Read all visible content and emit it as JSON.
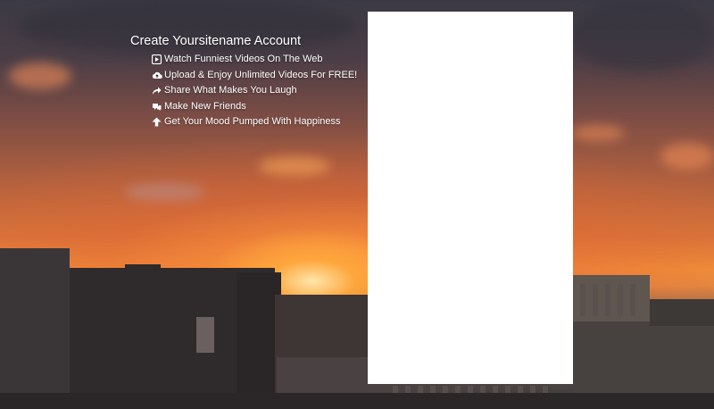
{
  "page": {
    "title": "Create Yoursitename Account"
  },
  "features": [
    {
      "icon": "play-square-icon",
      "label": "Watch Funniest Videos On The Web"
    },
    {
      "icon": "cloud-upload-icon",
      "label": "Upload & Enjoy Unlimited Videos For FREE!"
    },
    {
      "icon": "share-arrow-icon",
      "label": "Share What Makes You Laugh"
    },
    {
      "icon": "users-icon",
      "label": "Make New Friends"
    },
    {
      "icon": "arrow-up-icon",
      "label": "Get Your Mood Pumped With Happiness"
    }
  ],
  "colors": {
    "text": "#ffffff",
    "panel": "#ffffff",
    "sunset_orange": "#f0913a"
  }
}
